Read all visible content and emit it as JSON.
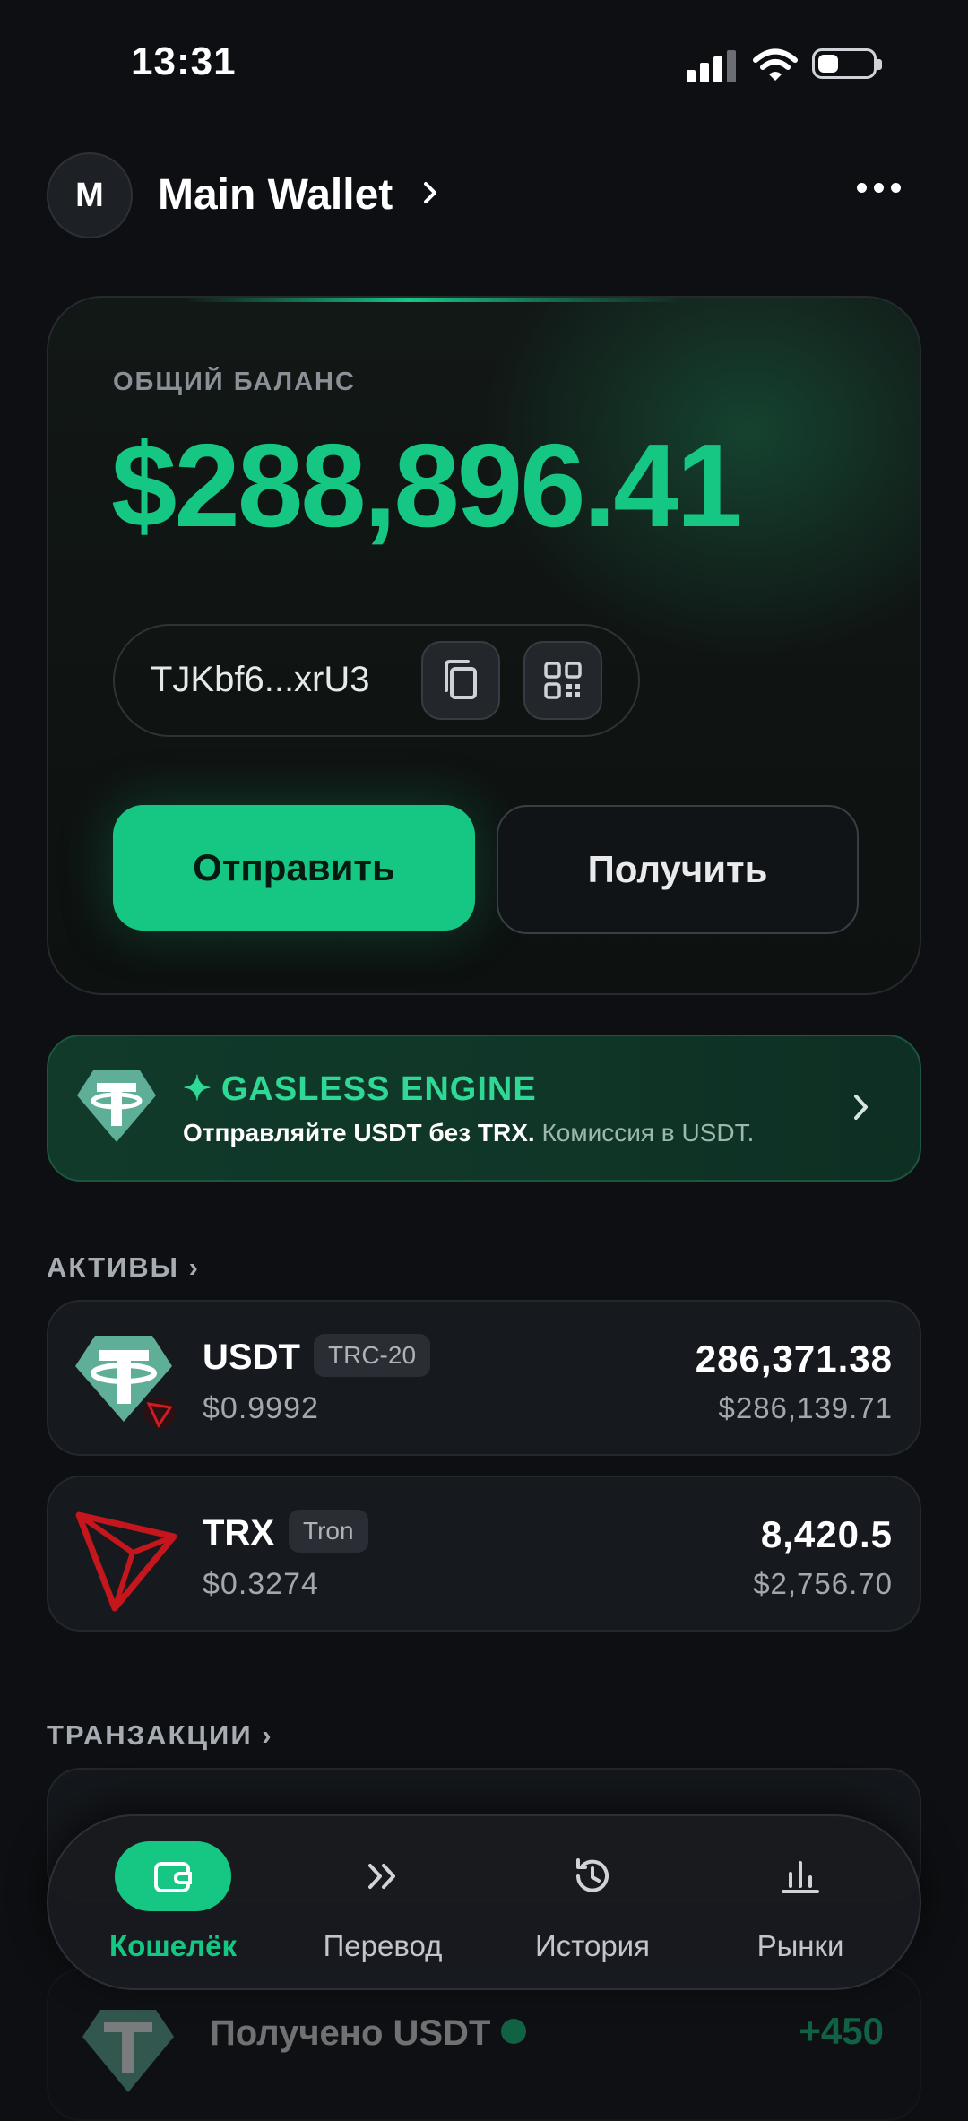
{
  "status_bar": {
    "time": "13:31"
  },
  "header": {
    "avatar_letter": "M",
    "wallet_name": "Main Wallet"
  },
  "balance_card": {
    "label": "ОБЩИЙ БАЛАНС",
    "value": "$288,896.41",
    "address": "TJKbf6...xrU3",
    "send_label": "Отправить",
    "receive_label": "Получить"
  },
  "gasless": {
    "title": "GASLESS ENGINE",
    "subtitle_main": "Отправляйте USDT без TRX.",
    "subtitle_secondary": "Комиссия в USDT."
  },
  "assets": {
    "title": "АКТИВЫ",
    "items": [
      {
        "symbol": "USDT",
        "network": "TRC-20",
        "price": "$0.9992",
        "amount": "286,371.38",
        "usd_value": "$286,139.71",
        "icon": "tether-icon"
      },
      {
        "symbol": "TRX",
        "network": "Tron",
        "price": "$0.3274",
        "amount": "8,420.5",
        "usd_value": "$2,756.70",
        "icon": "tron-icon"
      }
    ]
  },
  "transactions": {
    "title": "ТРАНЗАКЦИИ",
    "items": [
      {
        "title": "Получено USDT",
        "amount": "+450"
      }
    ]
  },
  "nav": {
    "items": [
      {
        "label": "Кошелёк",
        "icon": "wallet-icon",
        "active": true
      },
      {
        "label": "Перевод",
        "icon": "double-chevron-icon",
        "active": false
      },
      {
        "label": "История",
        "icon": "history-icon",
        "active": false
      },
      {
        "label": "Рынки",
        "icon": "bar-chart-icon",
        "active": false
      }
    ]
  },
  "colors": {
    "accent": "#16c784",
    "background": "#0d0f12",
    "tron_red": "#c4161c"
  }
}
